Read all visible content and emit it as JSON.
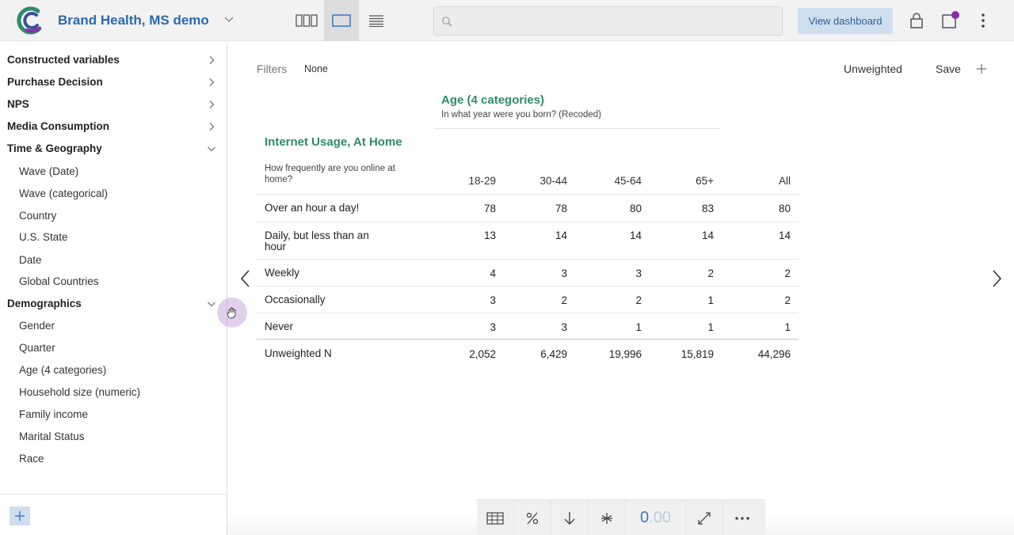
{
  "app": {
    "dataset_title": "Brand Health, MS demo",
    "view_dashboard_label": "View dashboard",
    "search_placeholder": ""
  },
  "colors": {
    "brand_blue": "#2a6ab0",
    "variable_green": "#2f8a6a",
    "accent_purple": "#8a2ab0",
    "button_blue_bg": "#cfdff0"
  },
  "icons": {
    "logo": "crunch-logo",
    "view_modes": [
      "three-column-view-icon",
      "single-panel-view-icon",
      "list-view-icon"
    ],
    "top_right": [
      "lock-icon",
      "notifications-icon",
      "more-vertical-icon"
    ],
    "toolbar": [
      "table-icon",
      "percent-icon",
      "sort-down-icon",
      "asterisk-icon",
      "decimals",
      "swap-icon",
      "more-horizontal-icon"
    ]
  },
  "sidebar": {
    "groups": [
      {
        "label": "Constructed variables",
        "expanded": false
      },
      {
        "label": "Purchase Decision",
        "expanded": false
      },
      {
        "label": "NPS",
        "expanded": false
      },
      {
        "label": "Media Consumption",
        "expanded": false
      },
      {
        "label": "Time & Geography",
        "expanded": true
      },
      {
        "label": "Demographics",
        "expanded": true
      }
    ],
    "time_geo_items": [
      "Wave (Date)",
      "Wave (categorical)",
      "Country",
      "U.S. State",
      "Date",
      "Global Countries"
    ],
    "demographics_items": [
      "Gender",
      "Quarter",
      "Age (4 categories)",
      "Household size (numeric)",
      "Family income",
      "Marital Status",
      "Race"
    ]
  },
  "main": {
    "filters_label": "Filters",
    "filters_value": "None",
    "weight_label": "Unweighted",
    "save_label": "Save"
  },
  "table": {
    "column_variable": {
      "title": "Age (4 categories)",
      "subtitle": "In what year were you born? (Recoded)"
    },
    "row_variable": {
      "title": "Internet Usage, At Home",
      "subtitle": "How frequently are you online at home?"
    },
    "columns": [
      "18-29",
      "30-44",
      "45-64",
      "65+",
      "All"
    ],
    "rows": [
      {
        "label": "Over an hour a day!",
        "values": [
          "78",
          "78",
          "80",
          "83",
          "80"
        ]
      },
      {
        "label": "Daily, but less than an hour",
        "values": [
          "13",
          "14",
          "14",
          "14",
          "14"
        ]
      },
      {
        "label": "Weekly",
        "values": [
          "4",
          "3",
          "3",
          "2",
          "2"
        ]
      },
      {
        "label": "Occasionally",
        "values": [
          "3",
          "2",
          "2",
          "1",
          "2"
        ]
      },
      {
        "label": "Never",
        "values": [
          "3",
          "3",
          "1",
          "1",
          "1"
        ]
      }
    ],
    "footer": {
      "label": "Unweighted N",
      "values": [
        "2,052",
        "6,429",
        "19,996",
        "15,819",
        "44,296"
      ]
    }
  },
  "toolbar": {
    "decimals_primary": "0",
    "decimals_secondary": ".00"
  }
}
